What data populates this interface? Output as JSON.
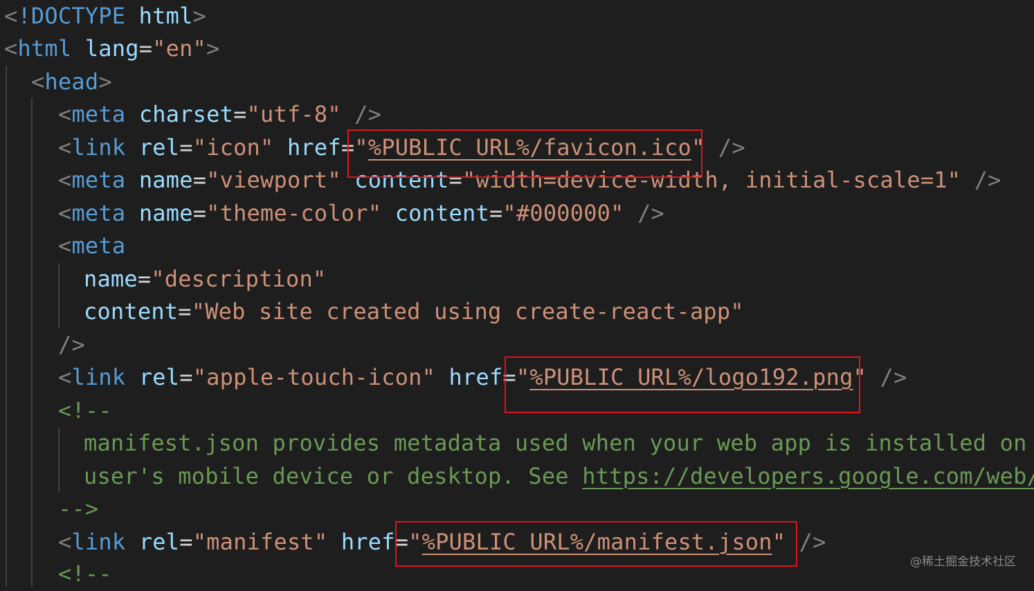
{
  "code": {
    "l1": {
      "lt": "<",
      "kw": "!DOCTYPE",
      "tag": "html",
      "gt": ">"
    },
    "l2": {
      "lt": "<",
      "tag": "html",
      "attr": "lang",
      "eq": "=",
      "val": "\"en\"",
      "gt": ">"
    },
    "l3": {
      "lt": "<",
      "tag": "head",
      "gt": ">"
    },
    "l4": {
      "lt": "<",
      "tag": "meta",
      "attr": "charset",
      "eq": "=",
      "val": "\"utf-8\"",
      "close": "/>"
    },
    "l5": {
      "lt": "<",
      "tag": "link",
      "attr1": "rel",
      "eq1": "=",
      "val1": "\"icon\"",
      "attr2": "href",
      "eq2": "=",
      "q1": "\"",
      "val2": "%PUBLIC_URL%/favicon.ico",
      "q2": "\"",
      "close": "/>"
    },
    "l6": {
      "lt": "<",
      "tag": "meta",
      "attr1": "name",
      "eq1": "=",
      "val1": "\"viewport\"",
      "attr2": "content",
      "eq2": "=",
      "val2": "\"width=device-width, initial-scale=1\"",
      "close": "/>"
    },
    "l7": {
      "lt": "<",
      "tag": "meta",
      "attr1": "name",
      "eq1": "=",
      "val1": "\"theme-color\"",
      "attr2": "content",
      "eq2": "=",
      "val2": "\"#000000\"",
      "close": "/>"
    },
    "l8": {
      "lt": "<",
      "tag": "meta"
    },
    "l9": {
      "attr": "name",
      "eq": "=",
      "val": "\"description\""
    },
    "l10": {
      "attr": "content",
      "eq": "=",
      "val": "\"Web site created using create-react-app\""
    },
    "l11": {
      "close": "/>"
    },
    "l12": {
      "lt": "<",
      "tag": "link",
      "attr1": "rel",
      "eq1": "=",
      "val1": "\"apple-touch-icon\"",
      "attr2": "href",
      "eq2": "=",
      "q1": "\"",
      "val2": "%PUBLIC_URL%/logo192.png",
      "q2": "\"",
      "close": "/>"
    },
    "l13": {
      "text": "<!--"
    },
    "l14": {
      "text": "manifest.json provides metadata used when your web app is installed on a"
    },
    "l15": {
      "text": "user's mobile device or desktop. See ",
      "link": "https://developers.google.com/web/f"
    },
    "l16": {
      "text": "-->"
    },
    "l17": {
      "lt": "<",
      "tag": "link",
      "attr1": "rel",
      "eq1": "=",
      "val1": "\"manifest\"",
      "attr2": "href",
      "eq2": "=",
      "q1": "\"",
      "val2": "%PUBLIC_URL%/manifest.json",
      "q2": "\"",
      "close": "/>"
    },
    "l18": {
      "text": "<!--"
    }
  },
  "watermark": "@稀土掘金技术社区",
  "colors": {
    "background": "#1e1e1e",
    "tag": "#569cd6",
    "attribute": "#9cdcfe",
    "string": "#ce9178",
    "comment": "#6a9955",
    "punctuation": "#808080",
    "highlight_box": "#e0141e"
  }
}
